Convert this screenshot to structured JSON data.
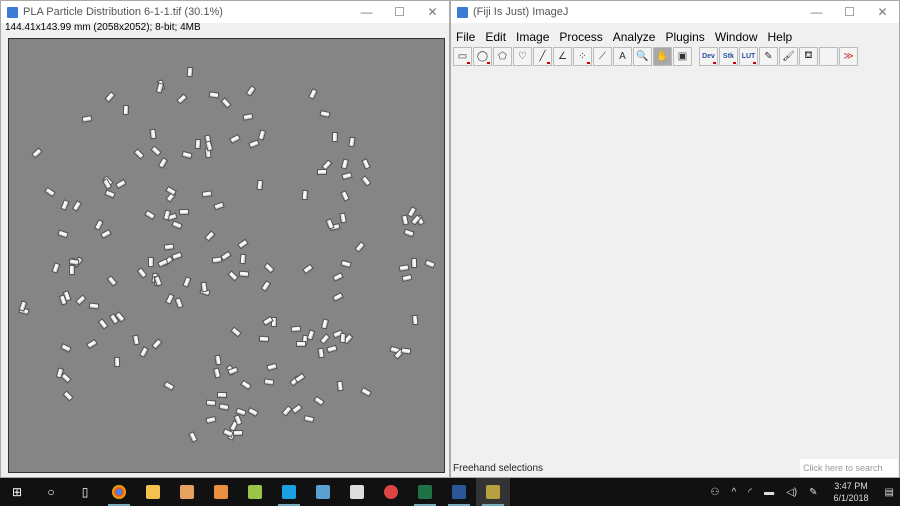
{
  "image_window": {
    "title": "PLA Particle Distribution 6-1-1.tif (30.1%)",
    "info": "144.41x143.99 mm (2058x2052); 8-bit; 4MB"
  },
  "imagej_window": {
    "title": "(Fiji Is Just) ImageJ",
    "menu": [
      "File",
      "Edit",
      "Image",
      "Process",
      "Analyze",
      "Plugins",
      "Window",
      "Help"
    ],
    "tools": [
      {
        "name": "rectangle-tool",
        "glyph": "▭"
      },
      {
        "name": "oval-tool",
        "glyph": "◯"
      },
      {
        "name": "polygon-tool",
        "glyph": "⬠"
      },
      {
        "name": "freehand-tool",
        "glyph": "♡"
      },
      {
        "name": "line-tool",
        "glyph": "╱"
      },
      {
        "name": "angle-tool",
        "glyph": "∠"
      },
      {
        "name": "multipoint-tool",
        "glyph": "⁘"
      },
      {
        "name": "wand-tool",
        "glyph": "⟋"
      },
      {
        "name": "text-tool",
        "glyph": "A"
      },
      {
        "name": "magnifier-tool",
        "glyph": "🔍"
      },
      {
        "name": "hand-tool",
        "glyph": "✋"
      },
      {
        "name": "color-picker-tool",
        "glyph": "▣"
      }
    ],
    "tools2": [
      "Dev",
      "Stk",
      "LUT"
    ],
    "tools3": [
      {
        "name": "pencil-tool",
        "glyph": "✎"
      },
      {
        "name": "brush-tool",
        "glyph": "🖌"
      },
      {
        "name": "flood-fill-tool",
        "glyph": "⛾"
      },
      {
        "name": "empty-tool",
        "glyph": ""
      },
      {
        "name": "more-tools",
        "glyph": "≫"
      }
    ],
    "status": "Freehand selections"
  },
  "taskbar": {
    "search_placeholder": "Click here to search",
    "time": "3:47 PM",
    "date": "6/1/2018"
  }
}
